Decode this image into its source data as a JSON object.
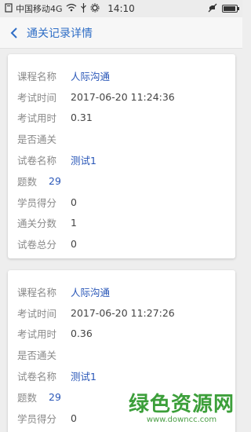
{
  "status_bar": {
    "carrier": "中国移动4G",
    "time": "14:10"
  },
  "nav": {
    "title": "通关记录详情",
    "back_icon": "chevron-left-icon"
  },
  "records": [
    {
      "course_label": "课程名称",
      "course_value": "人际沟通",
      "time_label": "考试时间",
      "time_value": "2017-06-20 11:24:36",
      "duration_label": "考试用时",
      "duration_value": "0.31",
      "pass_label": "是否通关",
      "pass_value": "",
      "paper_label": "试卷名称",
      "paper_value": "测试1",
      "count_label": "题数",
      "count_value": "29",
      "score_label": "学员得分",
      "score_value": "0",
      "pass_score_label": "通关分数",
      "pass_score_value": "1",
      "total_label": "试卷总分",
      "total_value": "0"
    },
    {
      "course_label": "课程名称",
      "course_value": "人际沟通",
      "time_label": "考试时间",
      "time_value": "2017-06-20 11:27:26",
      "duration_label": "考试用时",
      "duration_value": "0.36",
      "pass_label": "是否通关",
      "pass_value": "",
      "paper_label": "试卷名称",
      "paper_value": "测试1",
      "count_label": "题数",
      "count_value": "29",
      "score_label": "学员得分",
      "score_value": "0"
    }
  ],
  "watermark": {
    "main": "绿色资源网",
    "sub": "www.downcc.com"
  },
  "colors": {
    "accent": "#2f6ec6",
    "value_link": "#2a57b8",
    "label": "#8a8a8a",
    "watermark": "#3c9f3a"
  }
}
